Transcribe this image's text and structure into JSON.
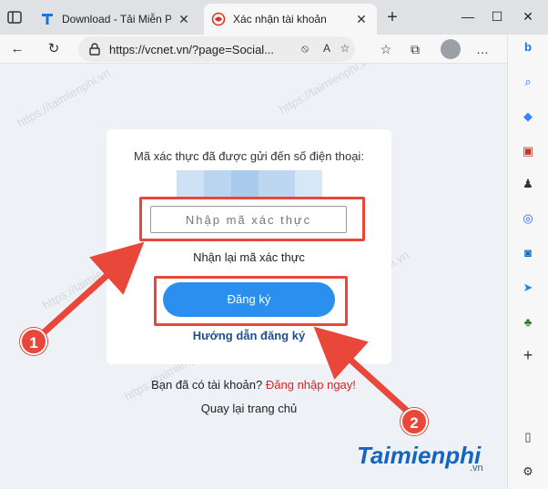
{
  "tabs": [
    {
      "title": "Download - Tải Miễn Phí VN",
      "active": false
    },
    {
      "title": "Xác nhận tài khoản",
      "active": true
    }
  ],
  "toolbar": {
    "url": "https://vcnet.vn/?page=Social..."
  },
  "card": {
    "message": "Mã xác thực đã được gửi đến số điện thoại:",
    "code_placeholder": "Nhập mã xác thực",
    "resend": "Nhận lại mã xác thực",
    "register": "Đăng ký",
    "guide": "Hướng dẫn đăng ký"
  },
  "footer": {
    "have_account": "Bạn đã có tài khoản?",
    "login": "Đăng nhập ngay!",
    "home": "Quay lại trang chủ"
  },
  "annotations": {
    "badge1": "1",
    "badge2": "2"
  },
  "watermark": "https://taimienphi.vn",
  "logo": {
    "main": "Taimienphi",
    "sub": ".vn"
  },
  "colors": {
    "accent": "#2b8ff0",
    "highlight": "#e8473a",
    "link_red": "#e02020"
  }
}
